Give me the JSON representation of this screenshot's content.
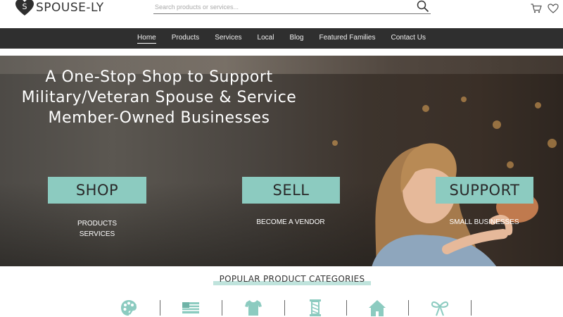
{
  "brand": {
    "name": "SPOUSE-LY",
    "mark": "S"
  },
  "search": {
    "placeholder": "Search products or services..."
  },
  "nav": {
    "items": [
      "Home",
      "Products",
      "Services",
      "Local",
      "Blog",
      "Featured Families",
      "Contact Us"
    ],
    "active": "Home"
  },
  "hero": {
    "title_lines": [
      "A One-Stop Shop to Support",
      "Military/Veteran Spouse & Service",
      "Member-Owned Businesses"
    ],
    "shop": {
      "label": "SHOP",
      "sub1": "PRODUCTS",
      "sub2": "SERVICES"
    },
    "sell": {
      "label": "SELL",
      "sub1": "BECOME A VENDOR"
    },
    "support": {
      "label": "SUPPORT",
      "sub1": "SMALL BUSINESSES"
    }
  },
  "categories": {
    "title": "POPULAR PRODUCT CATEGORIES",
    "icons": [
      "palette-icon",
      "flag-icon",
      "tshirt-icon",
      "thread-spool-icon",
      "home-icon",
      "bow-icon"
    ]
  },
  "colors": {
    "accent": "#8ccbc0",
    "nav_bg": "#2f2f2f",
    "icon": "#8ccbc0"
  }
}
